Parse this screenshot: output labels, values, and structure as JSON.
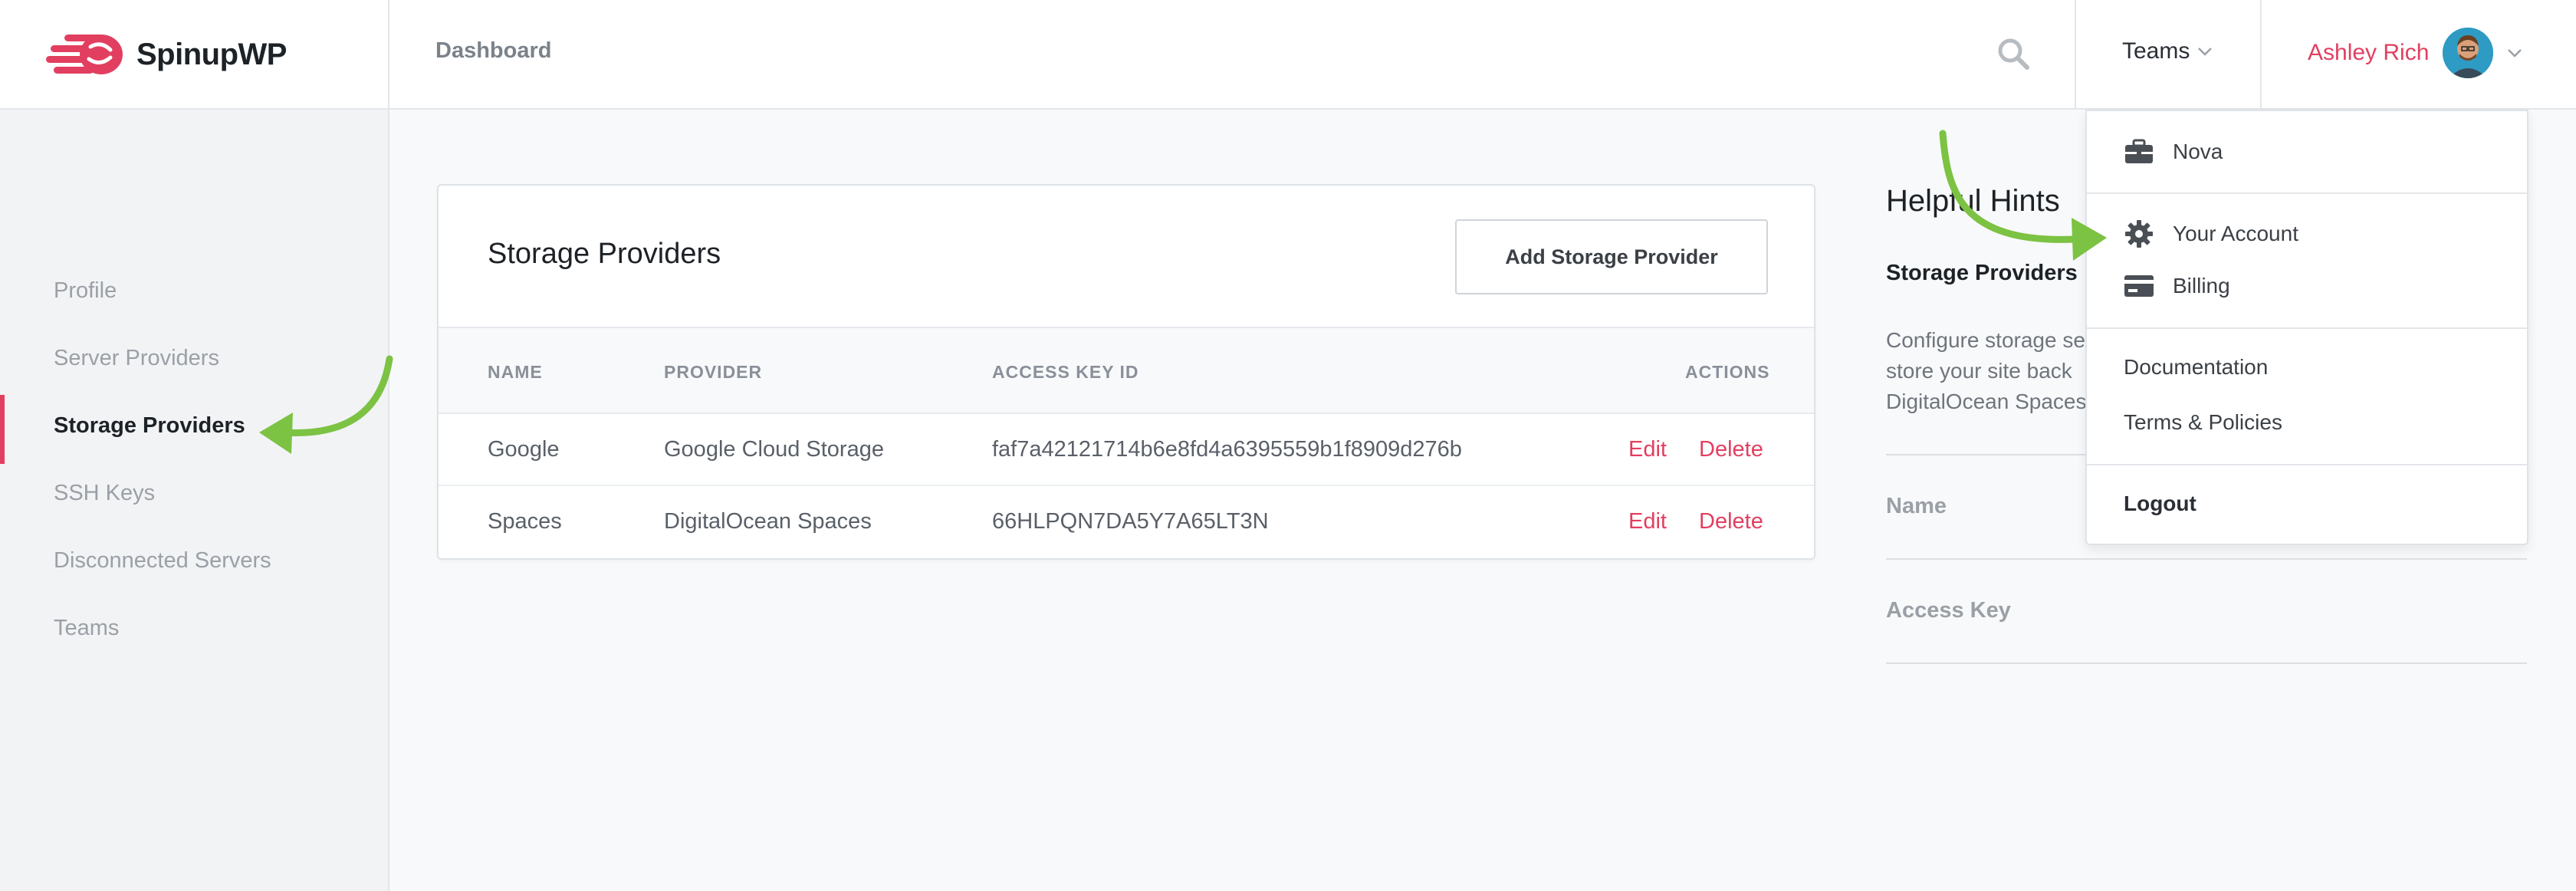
{
  "brand": {
    "name": "SpinupWP",
    "color": "#e23f60"
  },
  "header": {
    "nav_dashboard": "Dashboard",
    "search_icon": "search-icon",
    "teams_label": "Teams",
    "user_name": "Ashley Rich"
  },
  "sidebar": {
    "items": [
      {
        "label": "Profile",
        "active": false
      },
      {
        "label": "Server Providers",
        "active": false
      },
      {
        "label": "Storage Providers",
        "active": true
      },
      {
        "label": "SSH Keys",
        "active": false
      },
      {
        "label": "Disconnected Servers",
        "active": false
      },
      {
        "label": "Teams",
        "active": false
      }
    ]
  },
  "main": {
    "title": "Storage Providers",
    "add_button": "Add Storage Provider",
    "columns": [
      "NAME",
      "PROVIDER",
      "ACCESS KEY ID",
      "ACTIONS"
    ],
    "rows": [
      {
        "name": "Google",
        "provider": "Google Cloud Storage",
        "access_key_id": "faf7a42121714b6e8fd4a6395559b1f8909d276b",
        "edit": "Edit",
        "delete": "Delete"
      },
      {
        "name": "Spaces",
        "provider": "DigitalOcean Spaces",
        "access_key_id": "66HLPQN7DA5Y7A65LT3N",
        "edit": "Edit",
        "delete": "Delete"
      }
    ]
  },
  "hints": {
    "title": "Helpful Hints",
    "subtitle": "Storage Providers",
    "text": "Configure storage se store your site back DigitalOcean Spaces",
    "fields": [
      "Name",
      "Access Key"
    ]
  },
  "dropdown": {
    "items": [
      {
        "label": "Nova",
        "icon": "briefcase-icon"
      },
      {
        "label": "Your Account",
        "icon": "gear-icon"
      },
      {
        "label": "Billing",
        "icon": "credit-card-icon"
      },
      {
        "label": "Documentation"
      },
      {
        "label": "Terms & Policies"
      },
      {
        "label": "Logout"
      }
    ]
  }
}
